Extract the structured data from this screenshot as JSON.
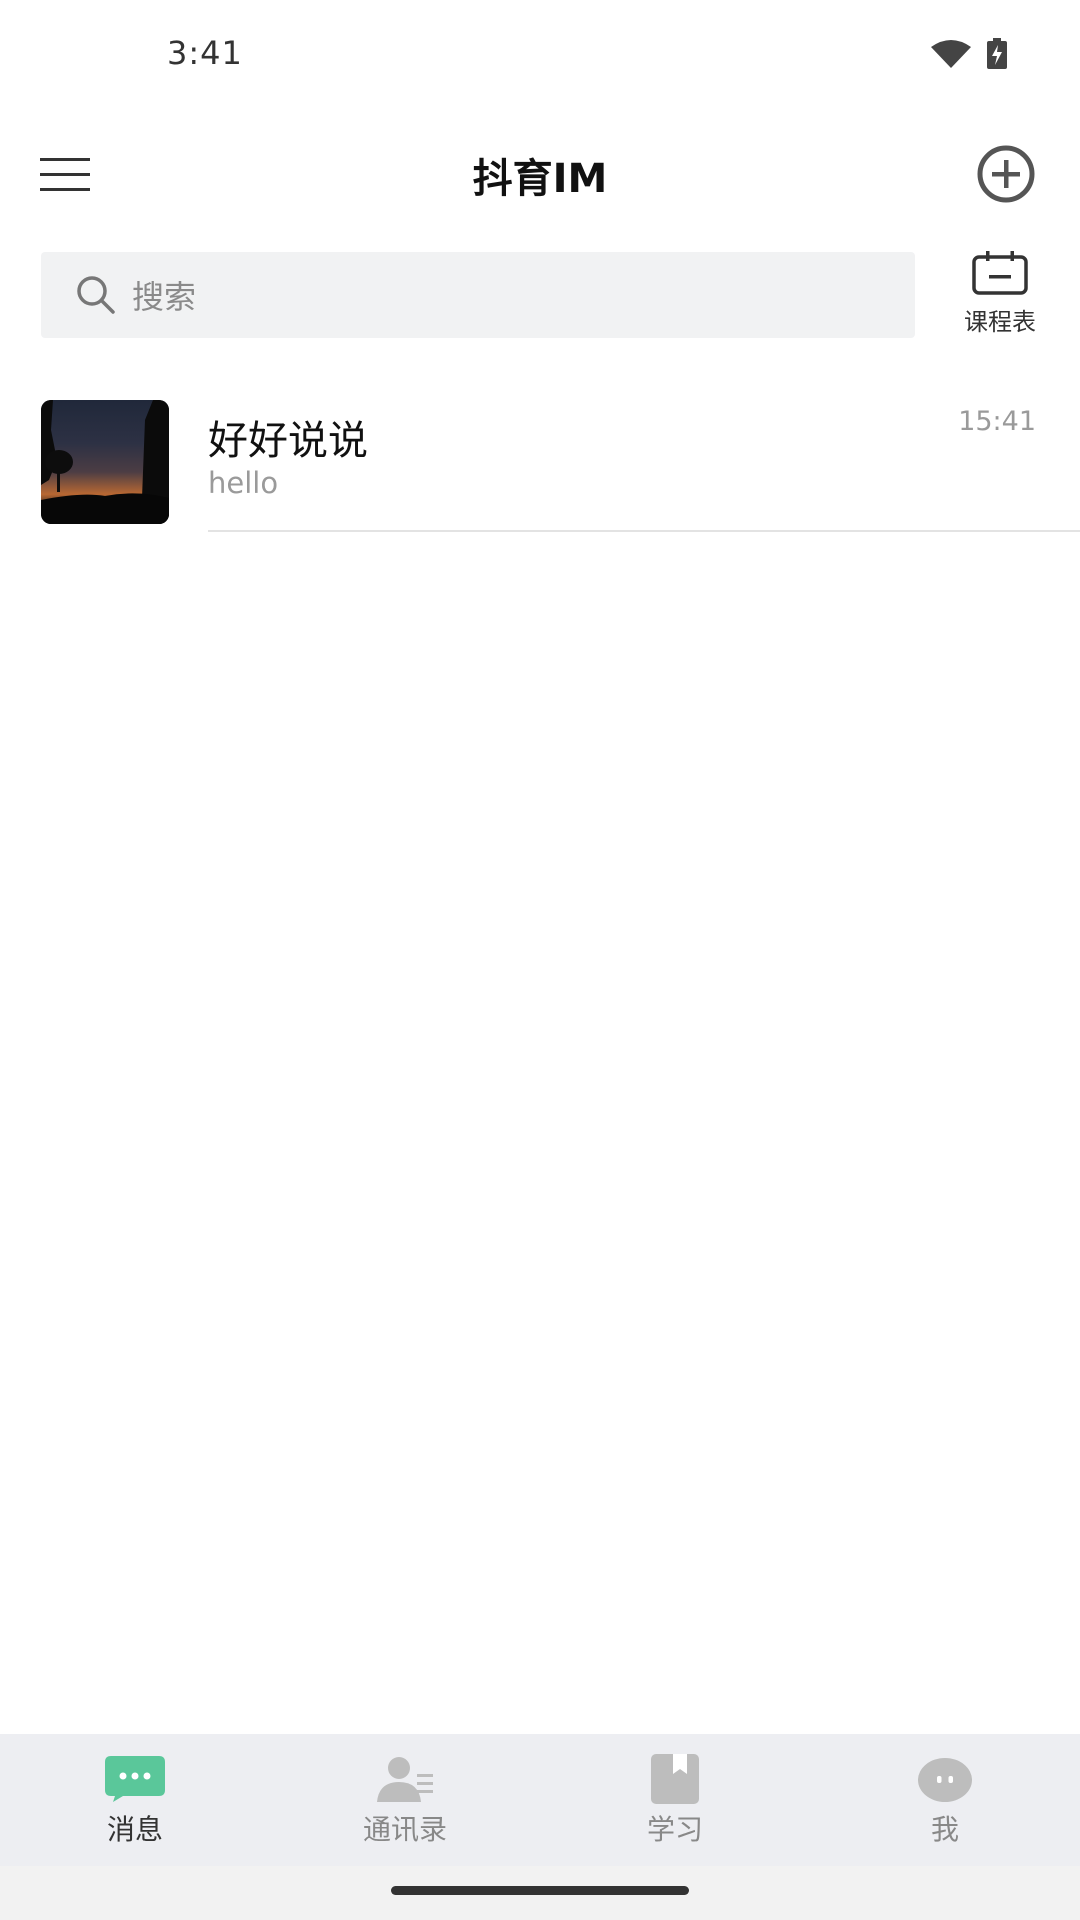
{
  "status_bar": {
    "time": "3:41"
  },
  "header": {
    "title": "抖育IM"
  },
  "search": {
    "placeholder": "搜索"
  },
  "schedule": {
    "label": "课程表"
  },
  "conversations": [
    {
      "name": "好好说说",
      "preview": "hello",
      "time": "15:41"
    }
  ],
  "tabs": [
    {
      "label": "消息",
      "icon": "chat-bubble-icon",
      "active": true
    },
    {
      "label": "通讯录",
      "icon": "contacts-icon",
      "active": false
    },
    {
      "label": "学习",
      "icon": "book-icon",
      "active": false
    },
    {
      "label": "我",
      "icon": "profile-icon",
      "active": false
    }
  ],
  "colors": {
    "accent": "#5ac79a",
    "tab_bg": "#edeef2",
    "search_bg": "#f1f2f3"
  }
}
